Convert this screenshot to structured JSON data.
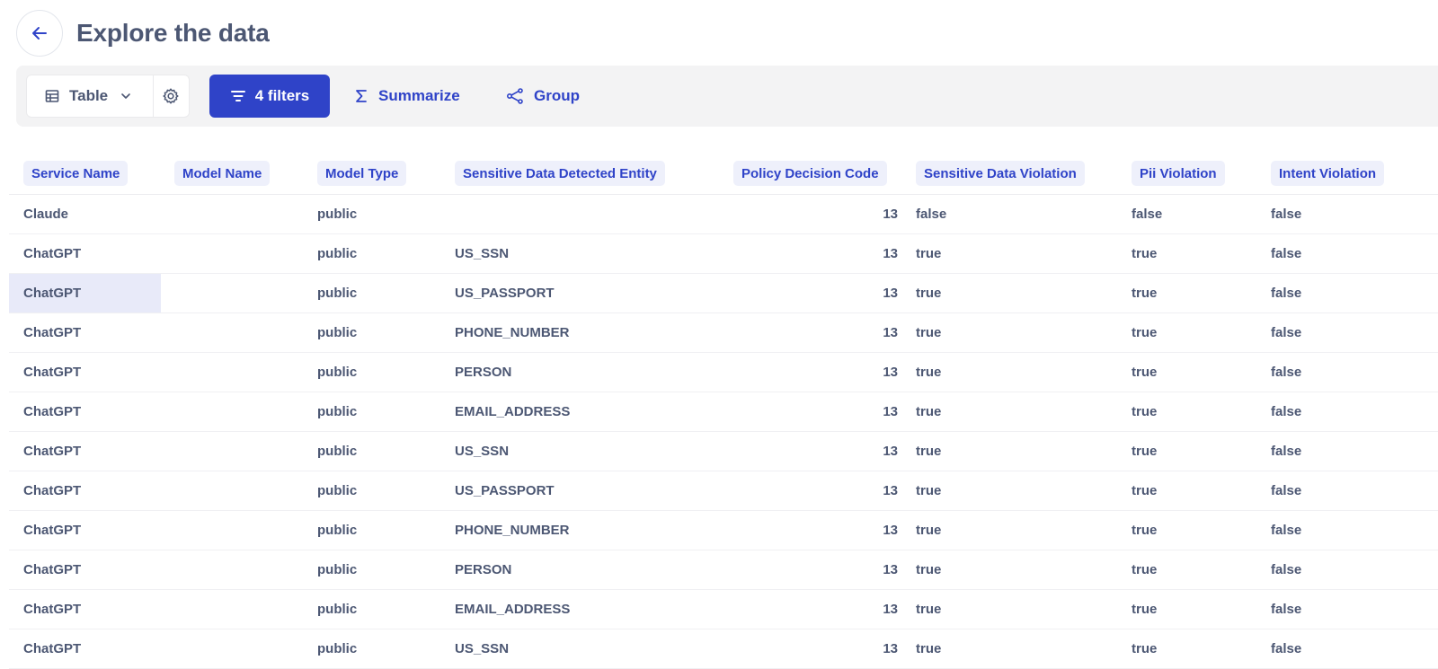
{
  "header": {
    "title": "Explore the data"
  },
  "toolbar": {
    "view_label": "Table",
    "filters_label": "4 filters",
    "summarize_label": "Summarize",
    "group_label": "Group"
  },
  "table": {
    "columns": [
      "Service Name",
      "Model Name",
      "Model Type",
      "Sensitive Data Detected Entity",
      "Policy Decision Code",
      "Sensitive Data Violation",
      "Pii Violation",
      "Intent Violation"
    ],
    "rows": [
      [
        "Claude",
        "",
        "public",
        "",
        "13",
        "false",
        "false",
        "false"
      ],
      [
        "ChatGPT",
        "",
        "public",
        "US_SSN",
        "13",
        "true",
        "true",
        "false"
      ],
      [
        "ChatGPT",
        "",
        "public",
        "US_PASSPORT",
        "13",
        "true",
        "true",
        "false"
      ],
      [
        "ChatGPT",
        "",
        "public",
        "PHONE_NUMBER",
        "13",
        "true",
        "true",
        "false"
      ],
      [
        "ChatGPT",
        "",
        "public",
        "PERSON",
        "13",
        "true",
        "true",
        "false"
      ],
      [
        "ChatGPT",
        "",
        "public",
        "EMAIL_ADDRESS",
        "13",
        "true",
        "true",
        "false"
      ],
      [
        "ChatGPT",
        "",
        "public",
        "US_SSN",
        "13",
        "true",
        "true",
        "false"
      ],
      [
        "ChatGPT",
        "",
        "public",
        "US_PASSPORT",
        "13",
        "true",
        "true",
        "false"
      ],
      [
        "ChatGPT",
        "",
        "public",
        "PHONE_NUMBER",
        "13",
        "true",
        "true",
        "false"
      ],
      [
        "ChatGPT",
        "",
        "public",
        "PERSON",
        "13",
        "true",
        "true",
        "false"
      ],
      [
        "ChatGPT",
        "",
        "public",
        "EMAIL_ADDRESS",
        "13",
        "true",
        "true",
        "false"
      ],
      [
        "ChatGPT",
        "",
        "public",
        "US_SSN",
        "13",
        "true",
        "true",
        "false"
      ]
    ]
  },
  "colors": {
    "accent": "#2f43c8",
    "header_chip": "#eef0fb",
    "text": "#4c5773",
    "selected_cell": "#e8eaf9"
  },
  "icons": [
    "arrow-left-icon",
    "table-icon",
    "chevron-down-icon",
    "gear-icon",
    "filter-icon",
    "sigma-icon",
    "group-icon"
  ]
}
